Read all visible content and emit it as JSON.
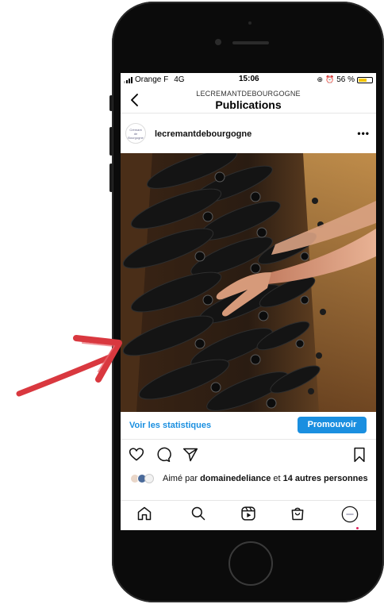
{
  "status_bar": {
    "carrier": "Orange F",
    "network": "4G",
    "time": "15:06",
    "battery": "56 %",
    "battery_level": 0.56
  },
  "nav": {
    "account": "LECREMANTDEBOURGOGNE",
    "title": "Publications"
  },
  "post": {
    "username": "lecremantdebourgogne",
    "avatar_text": "Crémant de Bourgogne",
    "image_alt": "Hand turning wine bottles on riddling racks in a cellar"
  },
  "promo_bar": {
    "stats_label": "Voir les statistiques",
    "promote_label": "Promouvoir"
  },
  "likes": {
    "prefix": "Aimé par ",
    "user": "domainedeliance",
    "middle": " et ",
    "others": "14 autres personnes"
  },
  "icons": {
    "back": "chevron-left-icon",
    "more": "more-horizontal-icon",
    "like": "heart-outline-icon",
    "comment": "comment-bubble-icon",
    "share": "paper-plane-icon",
    "save": "bookmark-icon",
    "tab_home": "home-icon",
    "tab_search": "search-icon",
    "tab_reels": "reels-icon",
    "tab_shop": "shop-bag-icon",
    "tab_profile": "profile-avatar-icon"
  },
  "colors": {
    "accent_blue": "#1a8fe0",
    "annotation_arrow": "#d9383f",
    "battery_yellow": "#f5c400",
    "notification_dot": "#e0245e"
  }
}
